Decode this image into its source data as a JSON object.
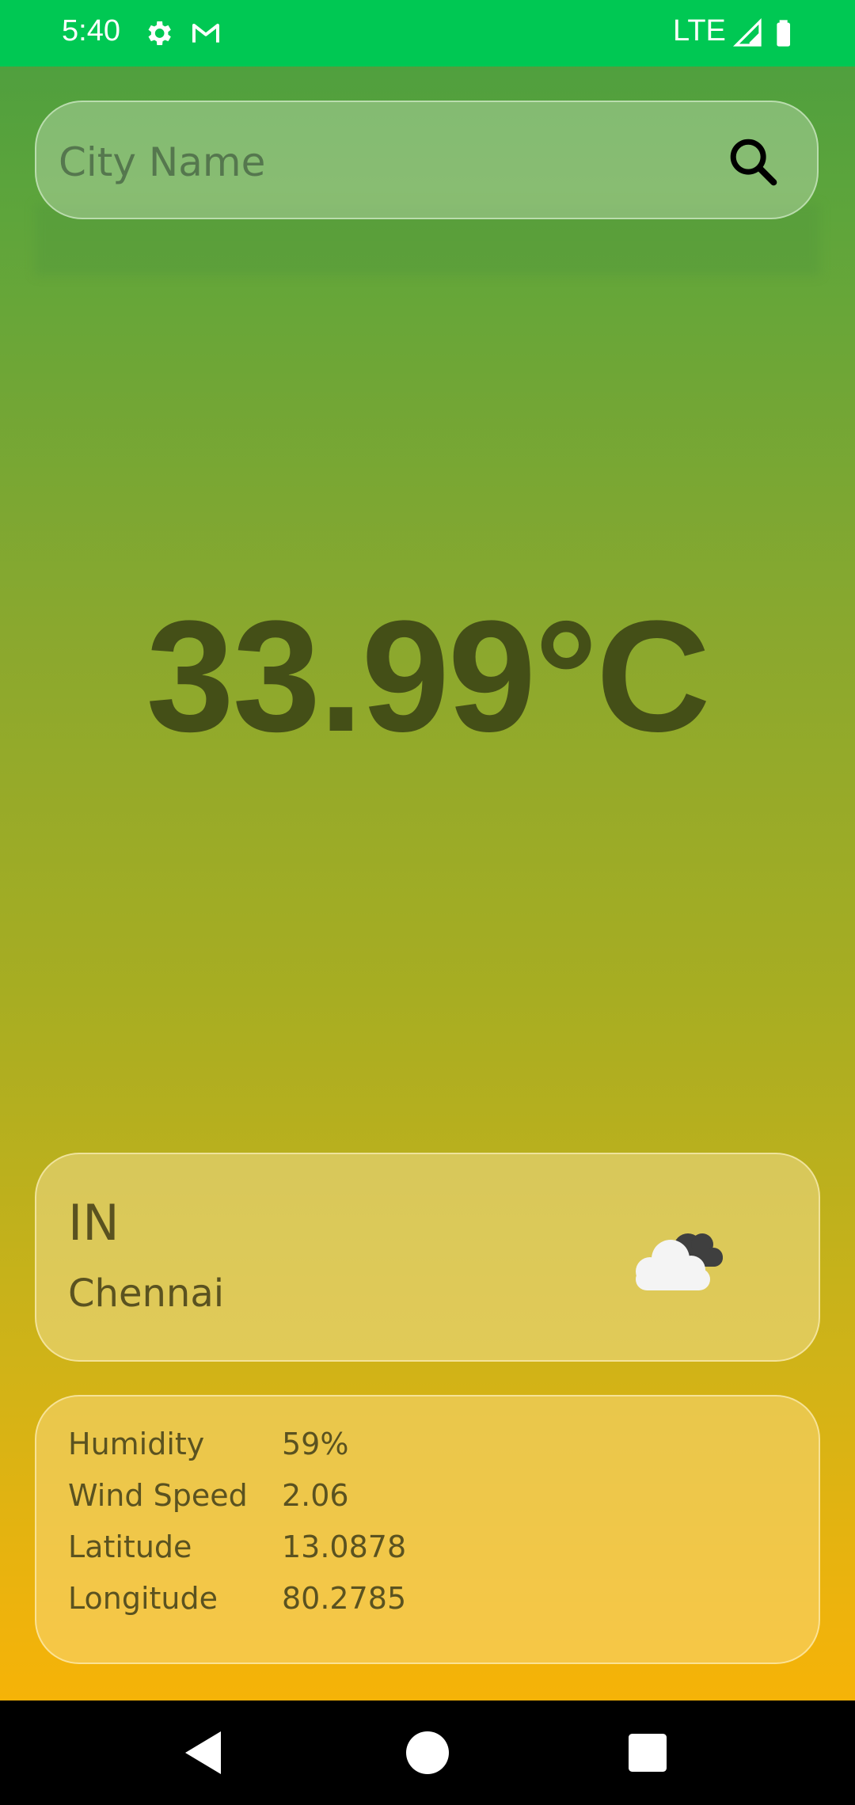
{
  "status_bar": {
    "time": "5:40",
    "network": "LTE",
    "icons": [
      "gear-icon",
      "gmail-icon",
      "signal-icon",
      "battery-icon"
    ],
    "background_color": "#00c853"
  },
  "search": {
    "placeholder": "City Name",
    "value": "",
    "button_icon": "search-icon"
  },
  "weather": {
    "temperature": "33.99°C",
    "country": "IN",
    "city": "Chennai",
    "condition_icon": "cloudy-icon"
  },
  "details": {
    "rows": [
      {
        "label": "Humidity",
        "value": "59%"
      },
      {
        "label": "Wind Speed",
        "value": "2.06"
      },
      {
        "label": "Latitude",
        "value": "13.0878"
      },
      {
        "label": "Longitude",
        "value": "80.2785"
      }
    ]
  },
  "nav_bar": {
    "buttons": [
      "back-icon",
      "home-icon",
      "recents-icon"
    ]
  }
}
